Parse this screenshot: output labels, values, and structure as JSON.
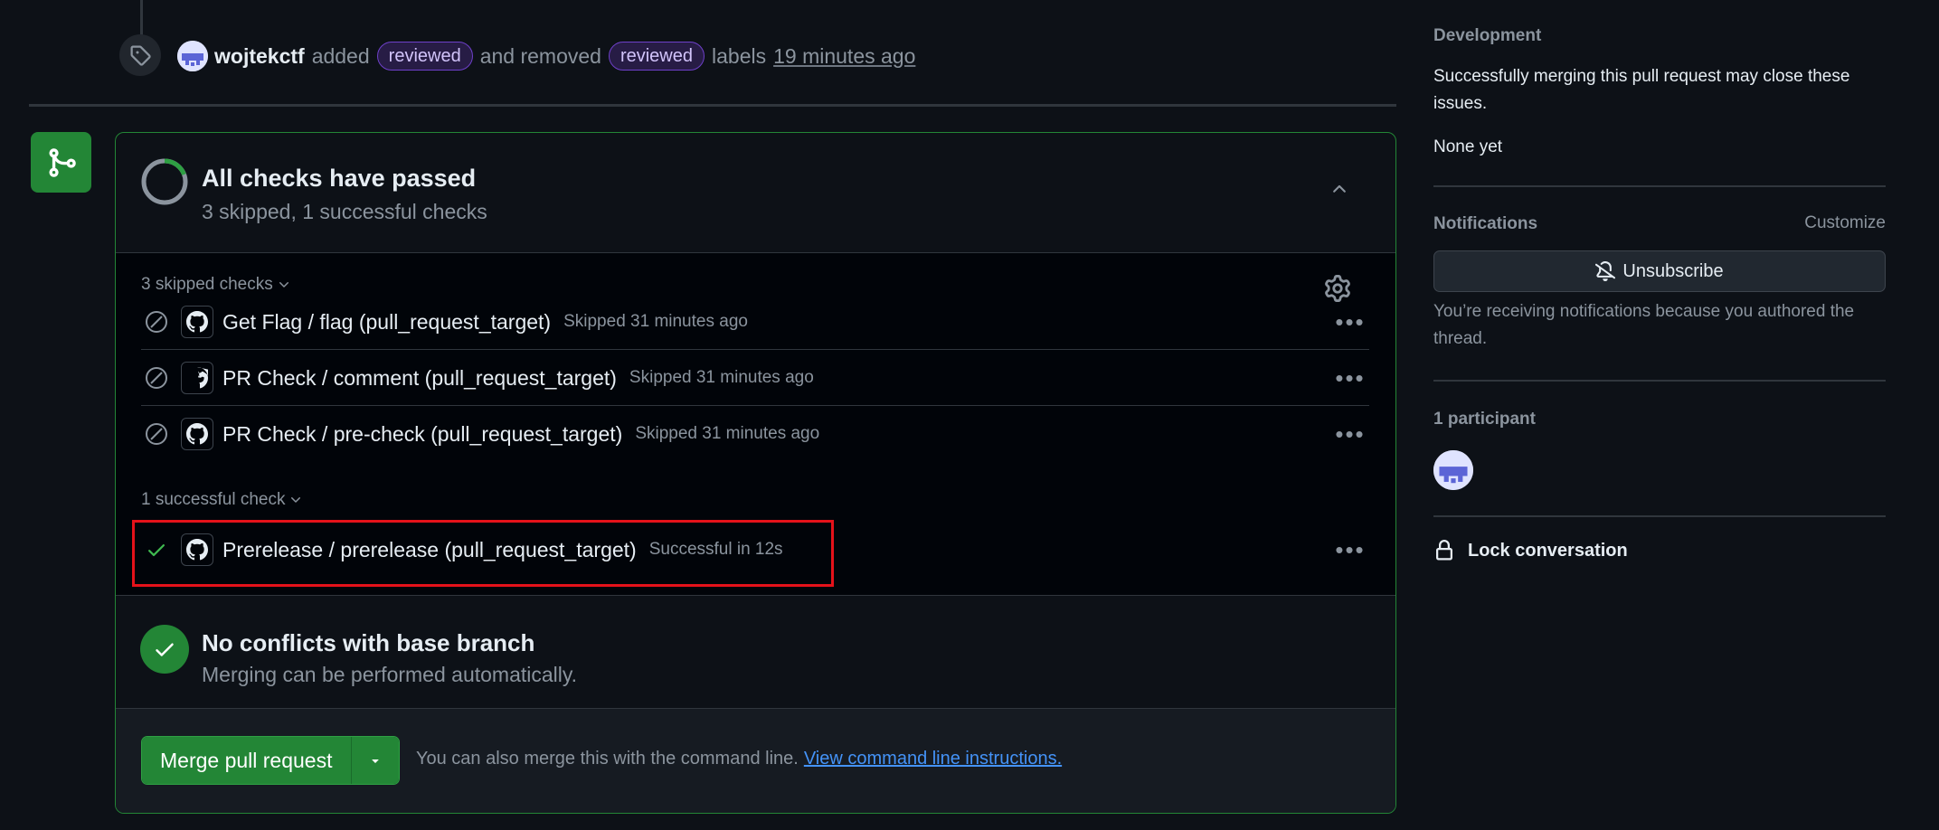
{
  "timeline": {
    "actor": "wojtekctf",
    "action_added": "added",
    "label_added": "reviewed",
    "action_removed": "and removed",
    "label_removed": "reviewed",
    "labels_word": "labels",
    "time": "19 minutes ago"
  },
  "mergebox": {
    "checks_title": "All checks have passed",
    "checks_subtitle": "3 skipped, 1 successful checks",
    "skipped_section": "3 skipped checks",
    "skipped_checks": [
      {
        "name": "Get Flag / flag (pull_request_target)",
        "status": "Skipped 31 minutes ago"
      },
      {
        "name": "PR Check / comment (pull_request_target)",
        "status": "Skipped 31 minutes ago"
      },
      {
        "name": "PR Check / pre-check (pull_request_target)",
        "status": "Skipped 31 minutes ago"
      }
    ],
    "successful_section": "1 successful check",
    "successful_checks": [
      {
        "name": "Prerelease / prerelease (pull_request_target)",
        "status": "Successful in 12s"
      }
    ],
    "conflicts_title": "No conflicts with base branch",
    "conflicts_subtitle": "Merging can be performed automatically.",
    "merge_button": "Merge pull request",
    "merge_hint": "You can also merge this with the command line.",
    "merge_link": "View command line instructions."
  },
  "sidebar": {
    "development_heading": "Development",
    "development_text": "Successfully merging this pull request may close these issues.",
    "development_none": "None yet",
    "notifications_heading": "Notifications",
    "customize_link": "Customize",
    "unsubscribe_button": "Unsubscribe",
    "notifications_reason": "You’re receiving notifications because you authored the thread.",
    "participants_heading": "1 participant",
    "lock_label": "Lock conversation"
  },
  "colors": {
    "background": "#0d1117",
    "success": "#238636",
    "label_purple": "#6e40c9",
    "link": "#4493f8",
    "highlight": "#e5121a"
  }
}
